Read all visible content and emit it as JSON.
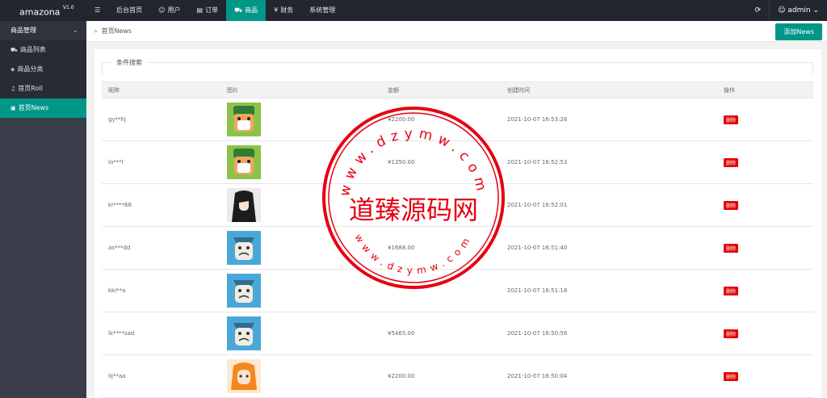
{
  "app": {
    "name": "amazona",
    "version": "V1.0"
  },
  "topnav": {
    "menu_icon": "menu-icon",
    "items": [
      {
        "label": "后台首页",
        "icon": ""
      },
      {
        "label": "用户",
        "icon": "user-icon"
      },
      {
        "label": "订单",
        "icon": "file-icon"
      },
      {
        "label": "商品",
        "icon": "cart-icon",
        "active": true
      },
      {
        "label": "财务",
        "icon": "yen-icon"
      },
      {
        "label": "系统管理",
        "icon": ""
      }
    ],
    "refresh_icon": "refresh-icon",
    "user": "admin"
  },
  "sidebar": {
    "group": "商品管理",
    "items": [
      {
        "label": "商品列表",
        "icon": "cart-icon"
      },
      {
        "label": "商品分类",
        "icon": "layers-icon"
      },
      {
        "label": "首页Roll",
        "icon": "bell-icon"
      },
      {
        "label": "首页News",
        "icon": "news-icon",
        "active": true
      }
    ]
  },
  "crumb": {
    "text": "首页News"
  },
  "add_button": "添加News",
  "search": {
    "legend": "条件搜索"
  },
  "table": {
    "headers": [
      "昵称",
      "图片",
      "金额",
      "创建时间",
      "操作"
    ],
    "rows": [
      {
        "name": "gy**hj",
        "amount": "¥2200.00",
        "time": "2021-10-07 16:53:26",
        "action": "删除",
        "img": "green-cat"
      },
      {
        "name": "lo***l",
        "amount": "¥1350.00",
        "time": "2021-10-07 16:52:53",
        "action": "删除",
        "img": "green-cat"
      },
      {
        "name": "ki****66",
        "amount": "",
        "time": "2021-10-07 16:52:01",
        "action": "删除",
        "img": "dark-hair"
      },
      {
        "name": "as***dd",
        "amount": "¥1688.00",
        "time": "2021-10-07 16:51:40",
        "action": "删除",
        "img": "blue-cat"
      },
      {
        "name": "kkl**a",
        "amount": "",
        "time": "2021-10-07 16:51:18",
        "action": "删除",
        "img": "blue-cat"
      },
      {
        "name": "lk****sad",
        "amount": "¥5465.00",
        "time": "2021-10-07 16:50:56",
        "action": "删除",
        "img": "blue-cat"
      },
      {
        "name": "lIj**aa",
        "amount": "¥2200.00",
        "time": "2021-10-07 16:50:04",
        "action": "删除",
        "img": "orange-girl"
      }
    ]
  },
  "watermark": {
    "center_text": "道臻源码网",
    "top_arc": "www.dzymw.com",
    "bottom_arc": "www.dzymw.com",
    "color": "#e60012"
  },
  "colors": {
    "accent": "#009688",
    "header": "#23262e",
    "sidebar": "#393d49",
    "danger": "#e60000"
  }
}
